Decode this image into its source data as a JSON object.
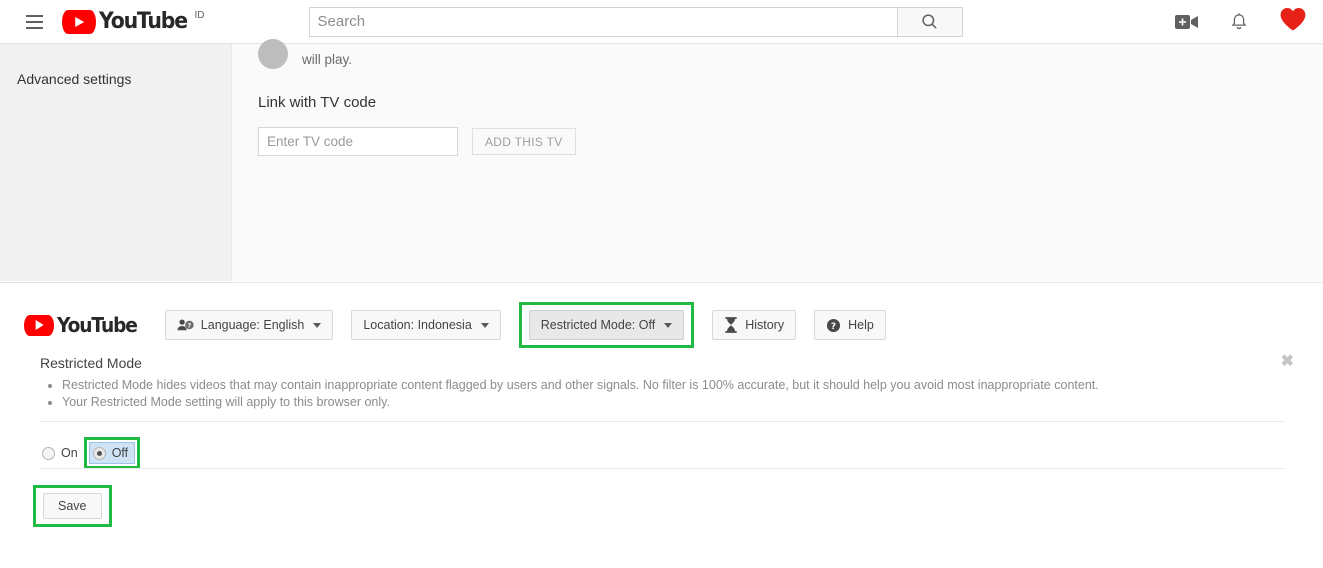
{
  "masthead": {
    "menu_icon": "hamburger-icon",
    "logo_text": "YouTube",
    "logo_country": "ID",
    "search": {
      "placeholder": "Search",
      "value": "",
      "button_icon": "search-icon"
    },
    "right_icons": [
      {
        "name": "create-video-icon",
        "label": "Create"
      },
      {
        "name": "notifications-bell-icon",
        "label": "Notifications"
      },
      {
        "name": "avatar-heart-icon",
        "label": "Account"
      }
    ],
    "avatar_color": "#e62117"
  },
  "sidebar": {
    "items": [
      {
        "label": "Advanced settings",
        "name": "sidebar-item-advanced"
      }
    ]
  },
  "content": {
    "partial_text": "will play.",
    "tv_heading": "Link with TV code",
    "tv_input_placeholder": "Enter TV code",
    "tv_input_value": "",
    "add_tv_label": "ADD THIS TV"
  },
  "footer_toolbar": {
    "logo_text": "YouTube",
    "buttons": [
      {
        "name": "language-button",
        "label": "Language: English",
        "icon": "account-question-icon",
        "active": false,
        "highlighted": false
      },
      {
        "name": "location-button",
        "label": "Location: Indonesia",
        "icon": "",
        "active": false,
        "highlighted": false
      },
      {
        "name": "restricted-mode-button",
        "label": "Restricted Mode: Off",
        "icon": "",
        "active": true,
        "highlighted": true
      },
      {
        "name": "history-button",
        "label": "History",
        "icon": "hourglass-icon",
        "active": false,
        "highlighted": false
      },
      {
        "name": "help-button",
        "label": "Help",
        "icon": "help-circle-icon",
        "active": false,
        "highlighted": false
      }
    ]
  },
  "restricted_panel": {
    "title": "Restricted Mode",
    "bullets": [
      "Restricted Mode hides videos that may contain inappropriate content flagged by users and other signals. No filter is 100% accurate, but it should help you avoid most inappropriate content.",
      "Your Restricted Mode setting will apply to this browser only."
    ],
    "close_label": "✖",
    "options": [
      {
        "label": "On",
        "name": "radio-on",
        "checked": false,
        "highlighted": false
      },
      {
        "label": "Off",
        "name": "radio-off",
        "checked": true,
        "highlighted": true
      }
    ],
    "save_label": "Save"
  },
  "colors": {
    "brand_red": "#ff0000",
    "highlight_green": "#21ba45",
    "focus_blue": "#cfe3f7",
    "sidebar_bg": "#f1f1f1",
    "content_bg": "#fafafa"
  }
}
